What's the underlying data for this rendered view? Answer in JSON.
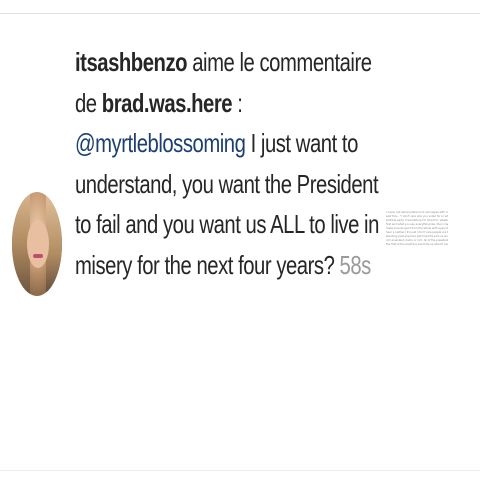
{
  "notification": {
    "liker_username": "itsashbenzo",
    "action_text": " aime le commentaire de ",
    "commenter_username": "brad.was.here",
    "separator": " :",
    "mention": "@myrtleblossoming",
    "comment_body": " I just want to understand, you want the President to fail and you want us ALL to live in misery for the next four years?",
    "timestamp": " 58s"
  },
  "side_text_lines": [
    "I never call about politics but I will agree with my friend the",
    "said this... \"I don't care who you voted for or what your",
    "political party. If something I'm hired for, whatever it happens",
    "first and what you say everything like, then crap just doesn't",
    "make sure its good from the whole with every thing should",
    "hear a neither I it's just I don't care people are too simple today",
    "standing post anymore just how this pick us and the should be",
    "rich president, damn or rich. All of the president and anything",
    "the first of the anything would be up about? Also said to all of"
  ],
  "colors": {
    "text": "#262626",
    "mention": "#1c3f73",
    "timestamp": "#9a9a9a",
    "divider": "#e2e2e2"
  }
}
